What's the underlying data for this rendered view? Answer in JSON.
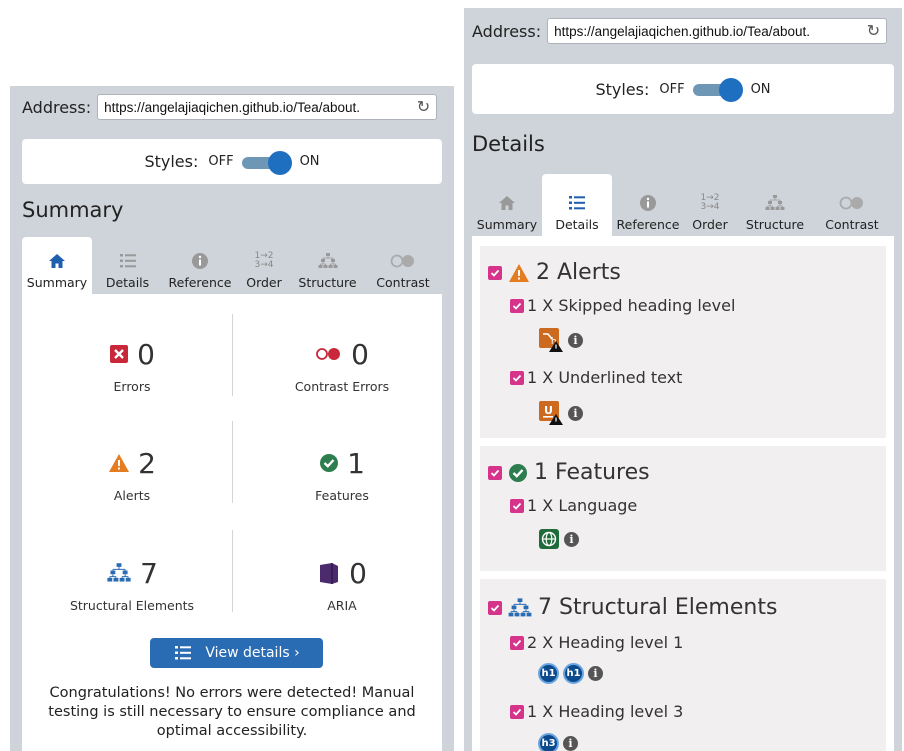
{
  "left": {
    "address_label": "Address:",
    "url": "https://angelajiaqichen.github.io/Tea/about.",
    "styles": {
      "label": "Styles:",
      "off": "OFF",
      "on": "ON"
    },
    "section_title": "Summary",
    "tabs": [
      {
        "label": "Summary",
        "icon": "home-icon",
        "active": true
      },
      {
        "label": "Details",
        "icon": "list-icon",
        "active": false
      },
      {
        "label": "Reference",
        "icon": "info-icon",
        "active": false
      },
      {
        "label": "Order",
        "icon": "order-icon",
        "active": false
      },
      {
        "label": "Structure",
        "icon": "structure-icon",
        "active": false
      },
      {
        "label": "Contrast",
        "icon": "contrast-icon",
        "active": false
      }
    ],
    "summary": {
      "errors": {
        "count": "0",
        "label": "Errors"
      },
      "contrast_errors": {
        "count": "0",
        "label": "Contrast Errors"
      },
      "alerts": {
        "count": "2",
        "label": "Alerts"
      },
      "features": {
        "count": "1",
        "label": "Features"
      },
      "structural": {
        "count": "7",
        "label": "Structural Elements"
      },
      "aria": {
        "count": "0",
        "label": "ARIA"
      }
    },
    "view_details": "View details ›",
    "congrats": "Congratulations! No errors were detected! Manual testing is still necessary to ensure compliance and optimal accessibility."
  },
  "right": {
    "address_label": "Address:",
    "url": "https://angelajiaqichen.github.io/Tea/about.",
    "styles": {
      "label": "Styles:",
      "off": "OFF",
      "on": "ON"
    },
    "section_title": "Details",
    "tabs": [
      {
        "label": "Summary",
        "icon": "home-icon",
        "active": false
      },
      {
        "label": "Details",
        "icon": "list-icon",
        "active": true
      },
      {
        "label": "Reference",
        "icon": "info-icon",
        "active": false
      },
      {
        "label": "Order",
        "icon": "order-icon",
        "active": false
      },
      {
        "label": "Structure",
        "icon": "structure-icon",
        "active": false
      },
      {
        "label": "Contrast",
        "icon": "contrast-icon",
        "active": false
      }
    ],
    "groups": {
      "alerts": {
        "title": "2 Alerts",
        "items": [
          "1 X Skipped heading level",
          "1 X Underlined text"
        ]
      },
      "features": {
        "title": "1 Features",
        "items": [
          "1 X Language"
        ]
      },
      "structural": {
        "title": "7 Structural Elements",
        "items": [
          "2 X Heading level 1",
          "1 X Heading level 3"
        ],
        "badges": {
          "h1": "h1",
          "h3": "h3"
        }
      }
    }
  },
  "colors": {
    "accent": "#2a6cb3",
    "toggle_knob": "#1f6fc1",
    "checkbox": "#d6338b",
    "error": "#c8283a",
    "alert": "#e57c1f",
    "feature": "#2e7d4f",
    "aria": "#4b2a6e"
  }
}
